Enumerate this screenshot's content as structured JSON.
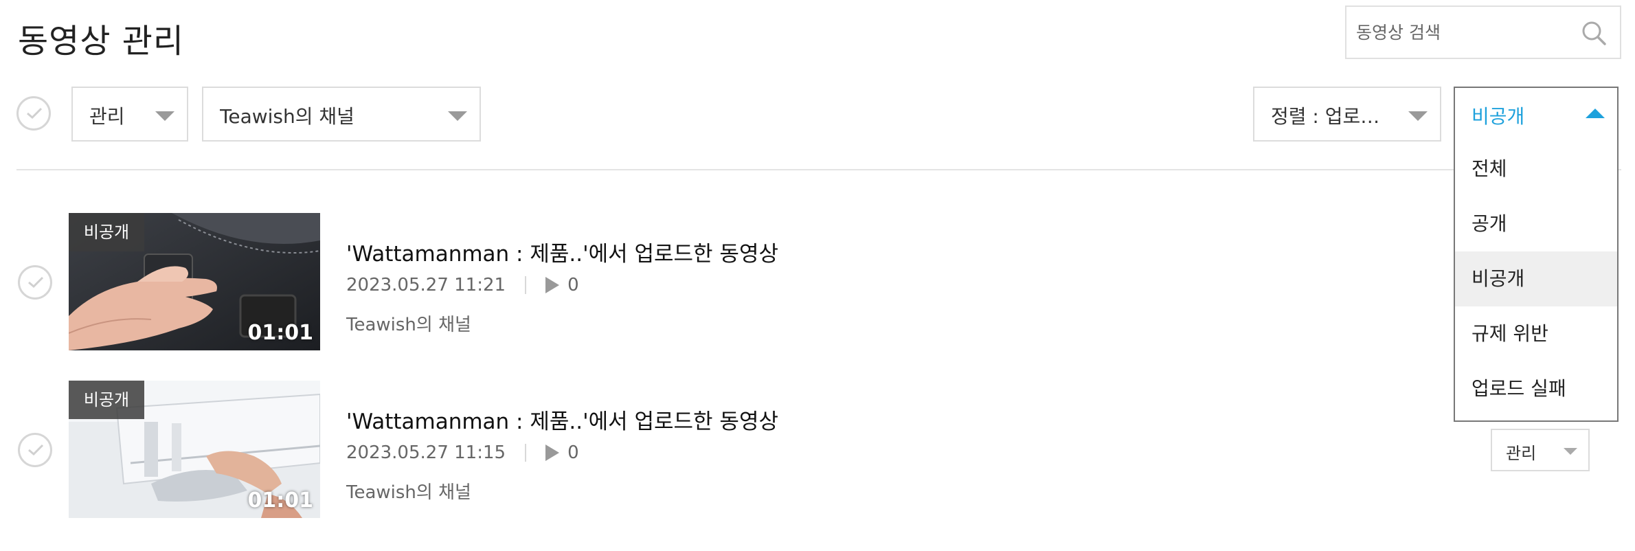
{
  "header": {
    "title": "동영상 관리",
    "search_placeholder": "동영상 검색"
  },
  "toolbar": {
    "manage_label": "관리",
    "channel_label": "Teawish의 채널",
    "sort_label": "정렬 : 업로…",
    "visibility_label": "비공개"
  },
  "visibility_dropdown": {
    "options": [
      "전체",
      "공개",
      "비공개",
      "규제 위반",
      "업로드 실패"
    ],
    "selected": "비공개"
  },
  "videos": [
    {
      "badge": "비공개",
      "duration": "01:01",
      "title": "'Wattamanman : 제품..'에서 업로드한 동영상",
      "date": "2023.05.27 11:21",
      "views": "0",
      "channel": "Teawish의 채널"
    },
    {
      "badge": "비공개",
      "duration": "01:01",
      "title": "'Wattamanman : 제품..'에서 업로드한 동영상",
      "date": "2023.05.27 11:15",
      "views": "0",
      "channel": "Teawish의 채널",
      "manage_label": "관리"
    }
  ],
  "colors": {
    "accent": "#1ea1dc",
    "active_option_bg": "#efefef",
    "badge_bg": "#3c3c3c"
  }
}
